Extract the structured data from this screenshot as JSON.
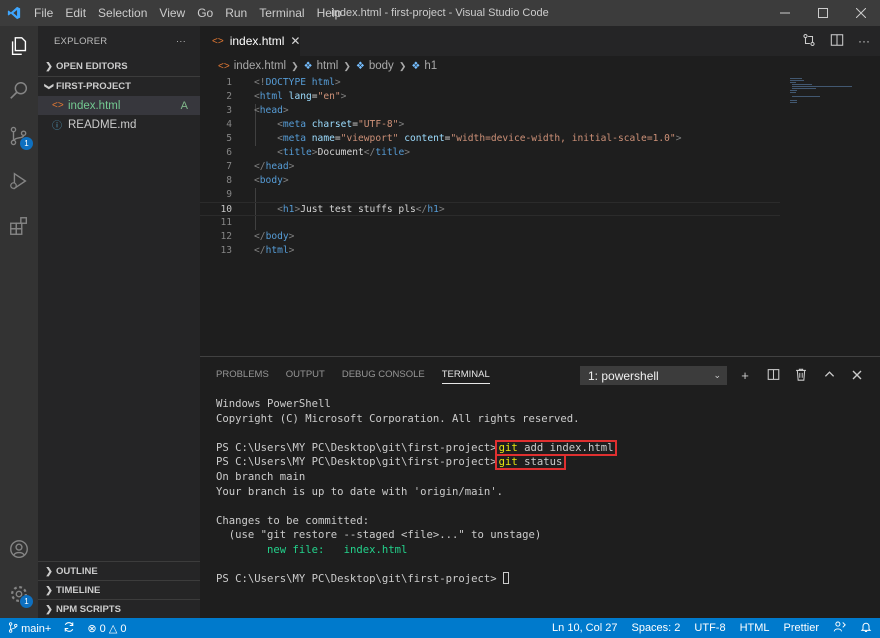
{
  "titlebar": {
    "menu": [
      "File",
      "Edit",
      "Selection",
      "View",
      "Go",
      "Run",
      "Terminal",
      "Help"
    ],
    "title": "index.html - first-project - Visual Studio Code",
    "icons": [
      "vscode-logo",
      "minimize-icon",
      "maximize-icon",
      "close-icon"
    ]
  },
  "activity_bar": {
    "items": [
      "explorer-icon",
      "search-icon",
      "source-control-icon",
      "run-debug-icon",
      "extensions-icon",
      "account-icon",
      "manage-gear-icon"
    ],
    "scm_badge": "1",
    "manage_badge": "1"
  },
  "sidebar": {
    "title": "EXPLORER",
    "more": "···",
    "open_editors": "OPEN EDITORS",
    "project": "FIRST-PROJECT",
    "files": [
      {
        "name": "index.html",
        "status": "A"
      },
      {
        "name": "README.md",
        "status": ""
      }
    ],
    "outline": "OUTLINE",
    "timeline": "TIMELINE",
    "npm_scripts": "NPM SCRIPTS"
  },
  "editor": {
    "tab_label": "index.html",
    "breadcrumb": [
      "index.html",
      "html",
      "body",
      "h1"
    ],
    "line_numbers": [
      "1",
      "2",
      "3",
      "4",
      "5",
      "6",
      "7",
      "8",
      "9",
      "10",
      "11",
      "12",
      "13"
    ],
    "lines": [
      "<!DOCTYPE html>",
      "<html lang=\"en\">",
      "<head>",
      "    <meta charset=\"UTF-8\">",
      "    <meta name=\"viewport\" content=\"width=device-width, initial-scale=1.0\">",
      "    <title>Document</title>",
      "</head>",
      "<body>",
      "",
      "    <h1>Just test stuffs pls</h1>",
      "",
      "</body>",
      "</html>"
    ]
  },
  "panel": {
    "tabs": [
      "PROBLEMS",
      "OUTPUT",
      "DEBUG CONSOLE",
      "TERMINAL"
    ],
    "active_tab": "TERMINAL",
    "terminal_select": "1: powershell",
    "terminal": {
      "l1": "Windows PowerShell",
      "l2": "Copyright (C) Microsoft Corporation. All rights reserved.",
      "prompt": "PS C:\\Users\\MY PC\\Desktop\\git\\first-project>",
      "cmd1": "git add index.html",
      "cmd2": "git status",
      "o1": "On branch main",
      "o2": "Your branch is up to date with 'origin/main'.",
      "o3": "Changes to be committed:",
      "o4": "  (use \"git restore --staged <file>...\" to unstage)",
      "o5_label": "new file:",
      "o5_file": "index.html"
    }
  },
  "statusbar": {
    "branch": "main+",
    "errors": "0",
    "warnings": "0",
    "position": "Ln 10, Col 27",
    "spaces": "Spaces: 2",
    "encoding": "UTF-8",
    "language": "HTML",
    "prettier": "Prettier"
  }
}
